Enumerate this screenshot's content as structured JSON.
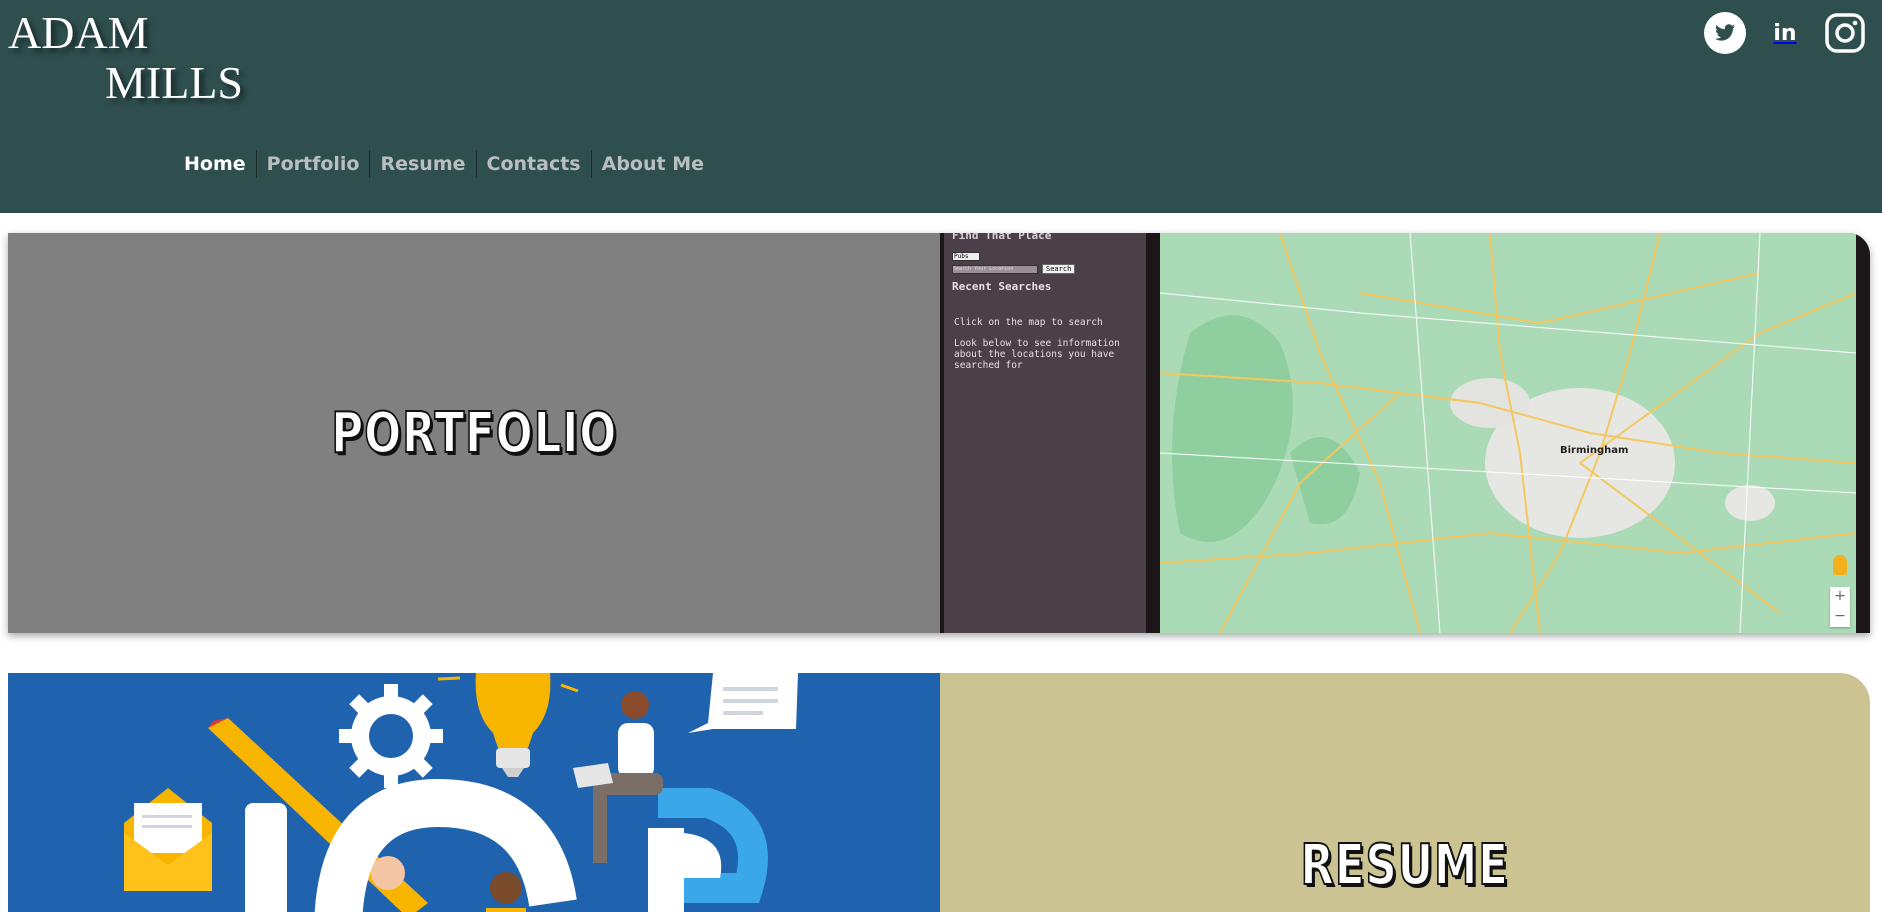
{
  "colors": {
    "header_bg": "#2f4f4f",
    "nav_active": "#ffffff",
    "nav_inactive": "#b9bfbf",
    "portfolio_bg": "#808080",
    "resume_bg": "#ccc393",
    "resume_image_bg": "#1f62ae"
  },
  "logo": {
    "line1": "ADAM",
    "line2": "MILLS"
  },
  "nav": {
    "items": [
      {
        "label": "Home",
        "active": true
      },
      {
        "label": "Portfolio",
        "active": false
      },
      {
        "label": "Resume",
        "active": false
      },
      {
        "label": "Contacts",
        "active": false
      },
      {
        "label": "About Me",
        "active": false
      }
    ]
  },
  "social": {
    "twitter": {
      "icon": "twitter-icon"
    },
    "linkedin": {
      "icon": "linkedin-icon",
      "text": "in"
    },
    "instagram": {
      "icon": "instagram-icon"
    }
  },
  "portfolio": {
    "label": "PORTFOLIO",
    "preview": {
      "title": "Find That Place",
      "select_value": "Pubs",
      "search_placeholder": "Search Your Location",
      "search_button": "Search",
      "recent_heading": "Recent Searches",
      "hint1": "Click on the map to search",
      "hint2": "Look below to see information about the locations you have searched for",
      "map_city": "Birmingham",
      "zoom_in": "+",
      "zoom_out": "−"
    }
  },
  "resume": {
    "label": "RESUME"
  }
}
